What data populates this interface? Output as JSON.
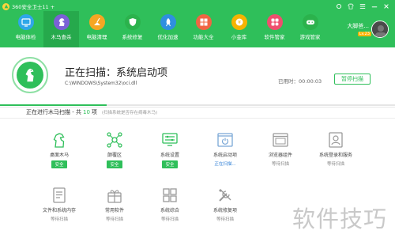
{
  "app": {
    "title": "360安全卫士11 +"
  },
  "window": {
    "controls": [
      "skin-icon",
      "shirt-icon",
      "menu-icon",
      "minimize-icon",
      "close-icon"
    ]
  },
  "nav": {
    "items": [
      {
        "label": "电脑体检",
        "icon": "monitor-icon",
        "color": "#2fa7e8"
      },
      {
        "label": "木马查杀",
        "icon": "horse-icon",
        "color": "#7b61d6",
        "active": true
      },
      {
        "label": "电脑清理",
        "icon": "broom-icon",
        "color": "#f5a623"
      },
      {
        "label": "系统修复",
        "icon": "shield-icon",
        "color": "#2bb24c"
      },
      {
        "label": "优化加速",
        "icon": "rocket-icon",
        "color": "#2f8fe0"
      },
      {
        "label": "功能大全",
        "icon": "grid-icon",
        "color": "#f06543"
      },
      {
        "label": "小金库",
        "icon": "coin-icon",
        "color": "#f5b301"
      },
      {
        "label": "软件管家",
        "icon": "apps-icon",
        "color": "#ef4f6e"
      },
      {
        "label": "游戏管家",
        "icon": "gamepad-icon",
        "color": "#2bb24c"
      }
    ]
  },
  "user": {
    "name": "大脚爸...",
    "level": "Lv.23"
  },
  "scan": {
    "title": "正在扫描：系统启动项",
    "path": "C:\\WINDOWS\\System32\\oci.dll",
    "elapsed_label": "已用时：00:00:03",
    "pause_label": "暂停扫描",
    "progress": 0.27
  },
  "status": {
    "prefix": "正在进行木马扫描 - 共",
    "count": "10",
    "suffix": "项",
    "hint": "(扫描系统是否存在病毒木马)"
  },
  "colors": {
    "brand": "#2fbf5a",
    "scanning": "#2f7fd6"
  },
  "items": [
    {
      "label": "桌面木马",
      "state": "安全",
      "type": "badge",
      "icon": "horse-outline-icon"
    },
    {
      "label": "颠覆区",
      "state": "安全",
      "type": "badge",
      "icon": "network-icon"
    },
    {
      "label": "系统设置",
      "state": "安全",
      "type": "badge",
      "icon": "settings-monitor-icon"
    },
    {
      "label": "系统启动项",
      "state": "正在扫描...",
      "type": "scanning",
      "icon": "power-window-icon"
    },
    {
      "label": "浏览器组件",
      "state": "等待扫描",
      "type": "wait",
      "icon": "browser-window-icon"
    },
    {
      "label": "系统登录和服务",
      "state": "等待扫描",
      "type": "wait",
      "icon": "user-login-icon"
    },
    {
      "label": "文件和系统内存",
      "state": "等待扫描",
      "type": "wait",
      "icon": "document-icon"
    },
    {
      "label": "常用软件",
      "state": "等待扫描",
      "type": "wait",
      "icon": "gift-icon"
    },
    {
      "label": "系统综合",
      "state": "等待扫描",
      "type": "wait",
      "icon": "windows-icon"
    },
    {
      "label": "系统修复项",
      "state": "等待扫描",
      "type": "wait",
      "icon": "tools-icon"
    }
  ],
  "watermark": "软件技巧"
}
